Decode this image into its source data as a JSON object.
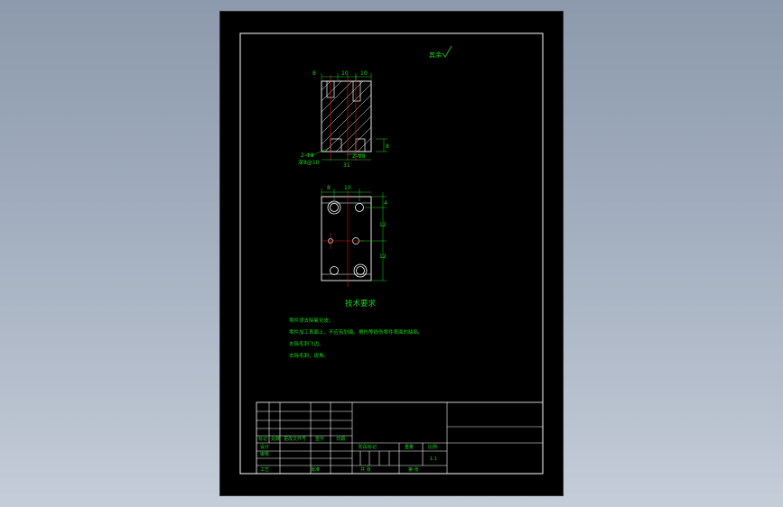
{
  "roughness_note": "其余",
  "top_view": {
    "dims": {
      "left": "8",
      "middle": "10",
      "right": "10",
      "height": "8",
      "width": "31",
      "bore": "2-Φ8"
    },
    "notes": [
      "2-Φ8",
      "深8@10"
    ]
  },
  "bottom_view": {
    "dims": {
      "left": "8",
      "middle": "10",
      "right_1": "4",
      "right_2": "12",
      "right_3": "12"
    }
  },
  "tech_requirements": {
    "title": "技术要求",
    "items": [
      "零件须去除氧化皮。",
      "零件加工表面上，不应有划痕、擦伤等损伤零件表面的缺陷。",
      "去除毛刺飞边。",
      "去除毛刺，锐角。"
    ]
  },
  "title_block": {
    "labels": [
      "标记",
      "处数",
      "更改文件号",
      "签字",
      "日期",
      "设计",
      "阶段标记",
      "重量",
      "比例",
      "审核",
      "工艺",
      "批准",
      "共 张",
      "第 张"
    ],
    "scale": "1:1"
  },
  "colors": {
    "background": "#000000",
    "line": "#ffffff",
    "text": "#19d419",
    "center": "#e01818"
  }
}
